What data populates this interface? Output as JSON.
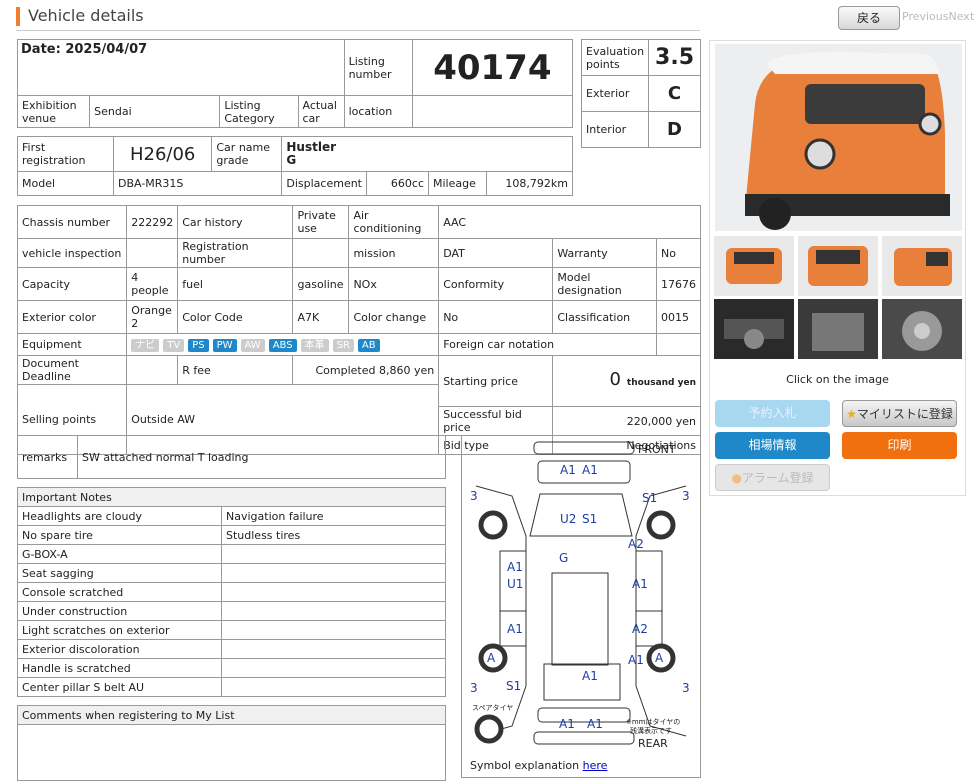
{
  "header": {
    "title": "Vehicle details",
    "back_label": "戻る",
    "prev_label": "Previous",
    "next_label": "Next"
  },
  "top": {
    "date": "Date: 2025/04/07",
    "listing_number_label": "Listing number",
    "listing_number": "40174",
    "exhibition_venue_label": "Exhibition venue",
    "exhibition_venue": "Sendai",
    "listing_category_label": "Listing Category",
    "listing_category": "Actual car",
    "location_label": "location",
    "evaluation_label": "Evaluation points",
    "evaluation": "3.5",
    "exterior_label": "Exterior",
    "exterior": "C",
    "interior_label": "Interior",
    "interior": "D"
  },
  "reg": {
    "first_reg_label": "First registration",
    "first_reg": "H26/06",
    "car_name_label": "Car name grade",
    "car_name": "Hustler",
    "grade": "G",
    "model_label": "Model",
    "model": "DBA-MR31S",
    "displacement_label": "Displacement",
    "displacement": "660cc",
    "mileage_label": "Mileage",
    "mileage": "108,792km"
  },
  "specs": {
    "chassis_label": "Chassis number",
    "chassis": "222292",
    "history_label": "Car history",
    "history": "Private use",
    "ac_label": "Air conditioning",
    "ac": "AAC",
    "inspection_label": "vehicle inspection",
    "regnum_label": "Registration number",
    "mission_label": "mission",
    "mission": "DAT",
    "warranty_label": "Warranty",
    "warranty": "No",
    "capacity_label": "Capacity",
    "capacity": "4 people",
    "fuel_label": "fuel",
    "fuel": "gasoline",
    "nox_label": "NOx",
    "conformity_label": "Conformity",
    "modeldes_label": "Model designation",
    "modeldes": "17676",
    "color_label": "Exterior color",
    "color": "Orange 2",
    "colorcode_label": "Color Code",
    "colorcode": "A7K",
    "colorchange_label": "Color change",
    "colorchange": "No",
    "class_label": "Classification",
    "class": "0015",
    "equipment_label": "Equipment",
    "equip": [
      "ナビ",
      "TV",
      "PS",
      "PW",
      "AW",
      "ABS",
      "本革",
      "SR",
      "AB"
    ],
    "foreign_label": "Foreign car notation",
    "deadline_label": "Document Deadline",
    "rfee_label": "R fee",
    "rfee": "Completed 8,860 yen",
    "starting_label": "Starting price",
    "starting": "0",
    "starting_unit": "thousand yen",
    "selling_label": "Selling points",
    "selling": "Outside AW",
    "bid_label": "Successful bid price",
    "bid": "220,000 yen",
    "bidtype_label": "Bid type",
    "bidtype": "Negotiations"
  },
  "remarks": {
    "label": "remarks",
    "value": "SW attached normal T loading"
  },
  "notes": {
    "title": "Important Notes",
    "rows": [
      [
        "Headlights are cloudy",
        "Navigation failure"
      ],
      [
        "No spare tire",
        "Studless tires"
      ],
      [
        "G-BOX-A",
        ""
      ],
      [
        "Seat sagging",
        ""
      ],
      [
        "Console scratched",
        ""
      ],
      [
        "Under construction",
        ""
      ],
      [
        "Light scratches on exterior",
        ""
      ],
      [
        "Exterior discoloration",
        ""
      ],
      [
        "Handle is scratched",
        ""
      ],
      [
        "Center pillar S belt AU",
        ""
      ]
    ]
  },
  "comments": {
    "title": "Comments when registering to My List"
  },
  "diagram": {
    "front": "FRONT",
    "rear": "REAR",
    "spare": "スペアタイヤ",
    "note1": "※mmはタイヤの",
    "note2": "残溝表示です",
    "marks": [
      "A1",
      "A1",
      "U2",
      "S1",
      "G",
      "S1",
      "A2",
      "A1",
      "U1",
      "A1",
      "A1",
      "A2",
      "A1",
      "A",
      "A",
      "S1",
      "A1",
      "A1",
      "A1",
      "3",
      "3",
      "3",
      "3"
    ],
    "symbol_label": "Symbol explanation",
    "symbol_link": "here"
  },
  "side": {
    "click_label": "Click on the image",
    "reserve": "予約入札",
    "mylist": "マイリストに登録",
    "market": "相場情報",
    "print": "印刷",
    "alarm": "アラーム登録"
  },
  "colors": {
    "accent": "#f08030",
    "blue": "#1e88c8",
    "orange": "#f07010"
  }
}
